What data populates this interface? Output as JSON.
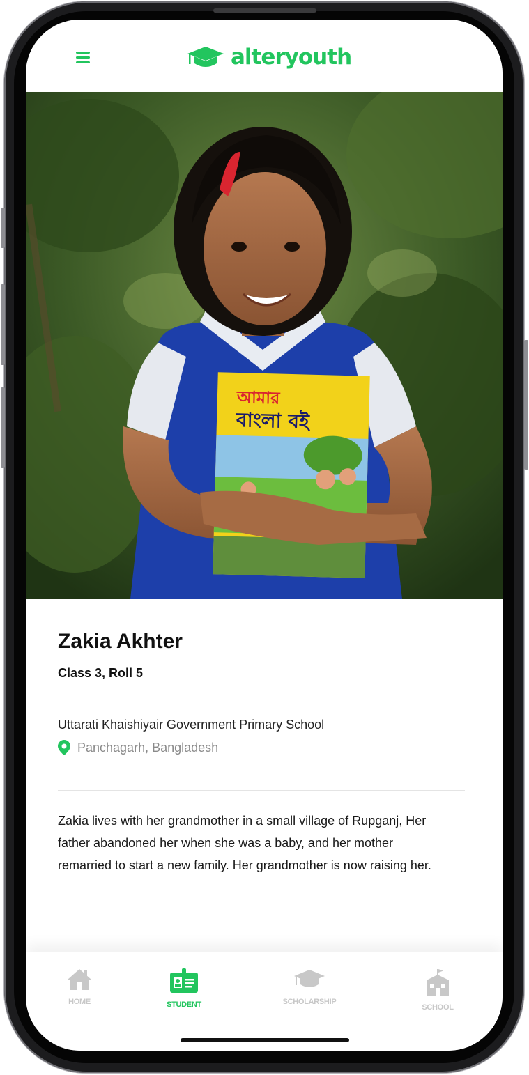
{
  "app": {
    "brand_name": "alteryouth",
    "accent_color": "#22c55e"
  },
  "header": {
    "menu_icon": "hamburger-menu-icon",
    "logo_icon": "graduation-cap-icon"
  },
  "student": {
    "name": "Zakia Akhter",
    "class_roll": "Class 3, Roll 5",
    "school": "Uttarati Khaishiyair Government Primary School",
    "location": "Panchagarh, Bangladesh",
    "location_icon": "map-pin-icon",
    "bio": "Zakia lives with her grandmother in a small village of Rupganj, Her father abandoned her when she was a baby, and her mother remarried to start a new family. Her grandmother is now raising her.",
    "photo_book_title_line1": "আমার",
    "photo_book_title_line2": "বাংলা বই"
  },
  "tabbar": {
    "tabs": [
      {
        "label": "HOME",
        "icon": "house-icon",
        "active": false
      },
      {
        "label": "STUDENT",
        "icon": "student-id-card-icon",
        "active": true
      },
      {
        "label": "SCHOLARSHIP",
        "icon": "graduation-cap-icon",
        "active": false
      },
      {
        "label": "SCHOOL",
        "icon": "school-building-icon",
        "active": false
      }
    ],
    "active_color": "#22c55e",
    "inactive_color": "#c8c8c8"
  }
}
